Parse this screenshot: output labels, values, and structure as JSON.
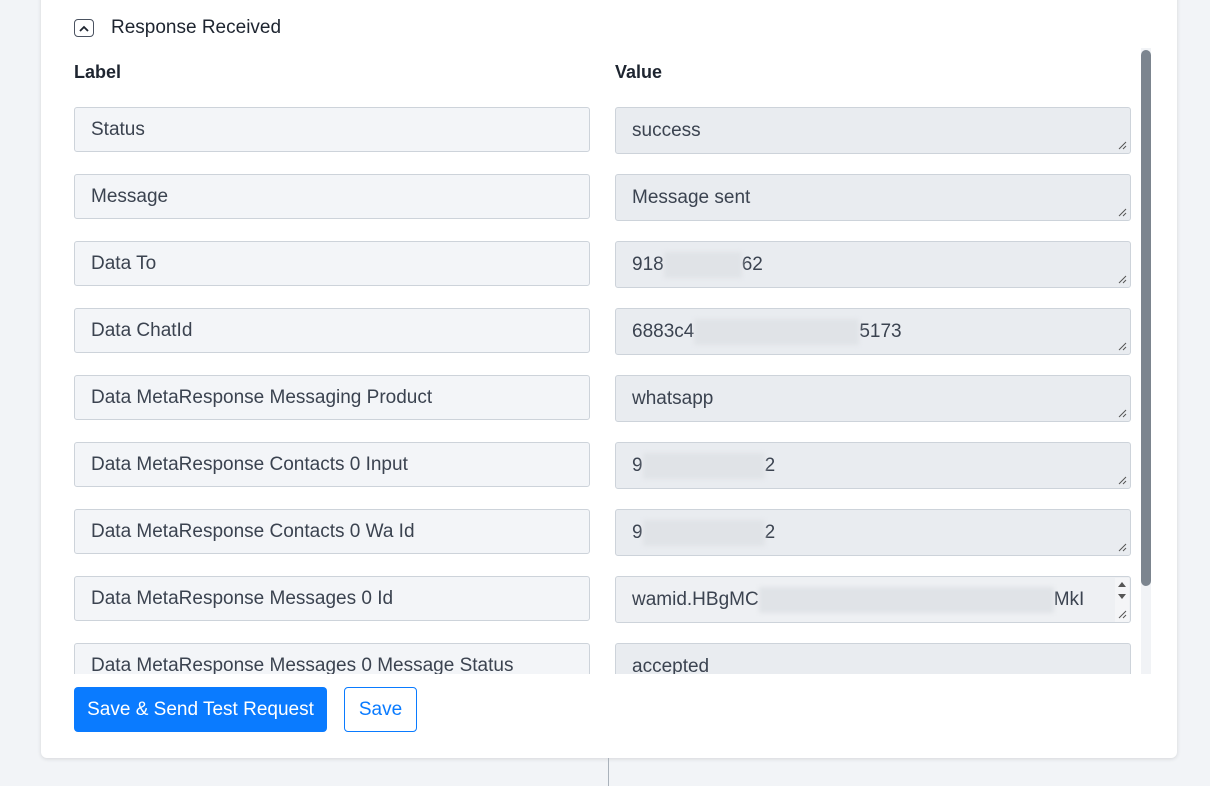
{
  "section": {
    "title": "Response Received",
    "toggle_icon": "chevron-up-icon"
  },
  "columns": {
    "label": "Label",
    "value": "Value"
  },
  "rows": [
    {
      "label": "Status",
      "value": "success",
      "value_prefix": "success",
      "value_suffix": ""
    },
    {
      "label": "Message",
      "value": "Message sent",
      "value_prefix": "Message sent",
      "value_suffix": ""
    },
    {
      "label": "Data To",
      "value_prefix": "918",
      "value_suffix": "62"
    },
    {
      "label": "Data ChatId",
      "value_prefix": "6883c4",
      "value_suffix": "5173"
    },
    {
      "label": "Data MetaResponse Messaging Product",
      "value_prefix": "whatsapp",
      "value_suffix": ""
    },
    {
      "label": "Data MetaResponse Contacts 0 Input",
      "value_prefix": "9",
      "value_suffix": "2"
    },
    {
      "label": "Data MetaResponse Contacts 0 Wa Id",
      "value_prefix": "9",
      "value_suffix": "2"
    },
    {
      "label": "Data MetaResponse Messages 0 Id",
      "value_prefix": "wamid.HBgMC",
      "value_suffix": "MkI"
    },
    {
      "label": "Data MetaResponse Messages 0 Message Status",
      "value_prefix": "accepted",
      "value_suffix": ""
    }
  ],
  "buttons": {
    "save_send": "Save & Send Test Request",
    "save": "Save"
  }
}
